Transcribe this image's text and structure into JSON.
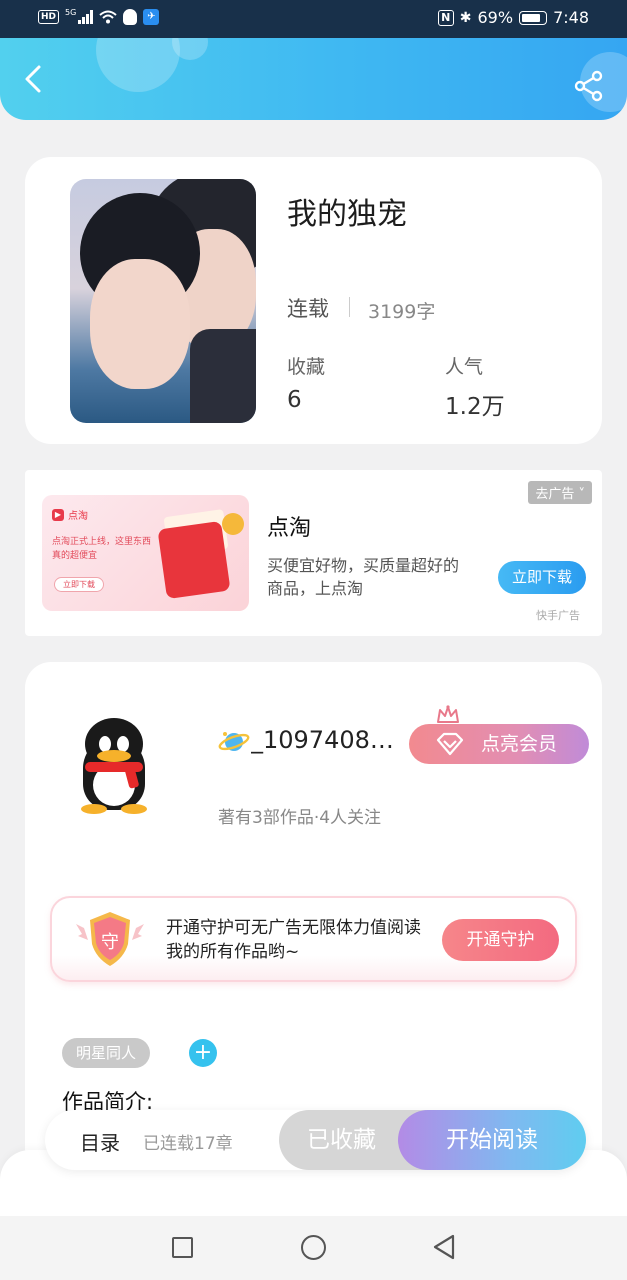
{
  "status_bar": {
    "hd": "HD",
    "signal_label": "5G",
    "battery": "69%",
    "time": "7:48"
  },
  "header": {
    "back_icon": "chevron-left-icon",
    "share_icon": "share-icon",
    "gradient": [
      "#52d0ee",
      "#35a6f2"
    ]
  },
  "book": {
    "title": "我的独宠",
    "status": "连载",
    "word_count": "3199字",
    "stats": [
      {
        "label": "收藏",
        "value": "6"
      },
      {
        "label": "人气",
        "value": "1.2万"
      }
    ]
  },
  "ad": {
    "tag": "去广告",
    "image": {
      "brand": "点淘",
      "text": "点淘正式上线，这里东西真的超便宜",
      "button": "立即下载"
    },
    "title": "点淘",
    "description": "买便宜好物，买质量超好的商品，上点淘",
    "download_label": "立即下载",
    "source": "快手广告"
  },
  "author": {
    "name": "_1097408…",
    "vip_label": "点亮会员",
    "meta": "著有3部作品·4人关注",
    "guard": {
      "icon_text": "守",
      "text": "开通守护可无广告无限体力值阅读我的所有作品哟~",
      "button": "开通守护"
    },
    "tag": "明星同人",
    "add_tag": "+",
    "intro_label": "作品简介:"
  },
  "bottom_bar": {
    "toc_label": "目录",
    "toc_sub": "已连载17章",
    "collected_label": "已收藏",
    "read_label": "开始阅读"
  },
  "colors": {
    "accent": "#35c2ee",
    "vip_gradient": [
      "#f28a8f",
      "#c08bd8"
    ],
    "guard_button": "#f36a80"
  }
}
